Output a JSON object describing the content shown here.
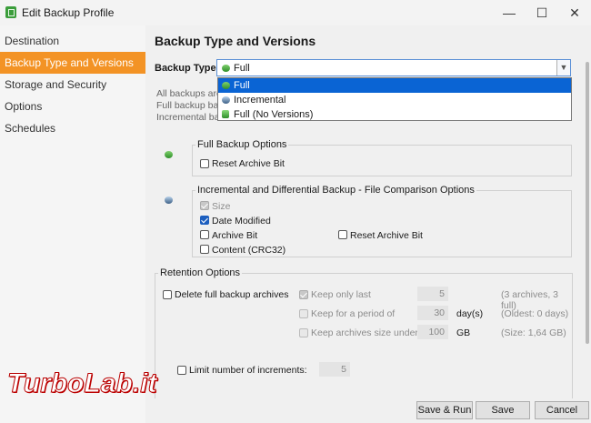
{
  "window": {
    "title": "Edit Backup Profile",
    "minimize": "—",
    "maximize": "☐",
    "close": "✕"
  },
  "sidebar": {
    "items": [
      {
        "label": "Destination"
      },
      {
        "label": "Backup Type and Versions",
        "active": true
      },
      {
        "label": "Storage and Security"
      },
      {
        "label": "Options"
      },
      {
        "label": "Schedules"
      }
    ]
  },
  "main": {
    "heading": "Backup Type and Versions",
    "backup_type_label": "Backup Type:",
    "backup_type_value": "Full",
    "dropdown_options": [
      "Full",
      "Incremental",
      "Full (No Versions)"
    ],
    "desc_lines": [
      "All backups are",
      "Full backup back",
      "Incremental bac"
    ],
    "full_options": {
      "title": "Full Backup Options",
      "reset_archive_bit": "Reset Archive Bit"
    },
    "incremental_options": {
      "title": "Incremental and Differential Backup - File Comparison Options",
      "size": "Size",
      "date_modified": "Date Modified",
      "archive_bit": "Archive Bit",
      "reset_archive_bit": "Reset Archive Bit",
      "content": "Content (CRC32)"
    },
    "retention": {
      "title": "Retention Options",
      "delete_full": "Delete full backup archives",
      "keep_only_last": "Keep only last",
      "keep_only_last_value": "5",
      "keep_only_last_info": "(3 archives, 3 full)",
      "keep_period": "Keep for a period of",
      "keep_period_value": "30",
      "keep_period_unit": "day(s)",
      "keep_period_info": "(Oldest: 0 days)",
      "keep_size": "Keep archives size under",
      "keep_size_value": "100",
      "keep_size_unit": "GB",
      "keep_size_info": "(Size: 1,64 GB)",
      "limit_increments": "Limit number of increments:",
      "limit_increments_value": "5"
    }
  },
  "footer": {
    "save_run": "Save & Run",
    "save": "Save",
    "cancel": "Cancel"
  },
  "watermark": "TurboLab.it",
  "colors": {
    "accent": "#f39325",
    "selection": "#0a64d4",
    "checkbox": "#1d5fbf"
  }
}
